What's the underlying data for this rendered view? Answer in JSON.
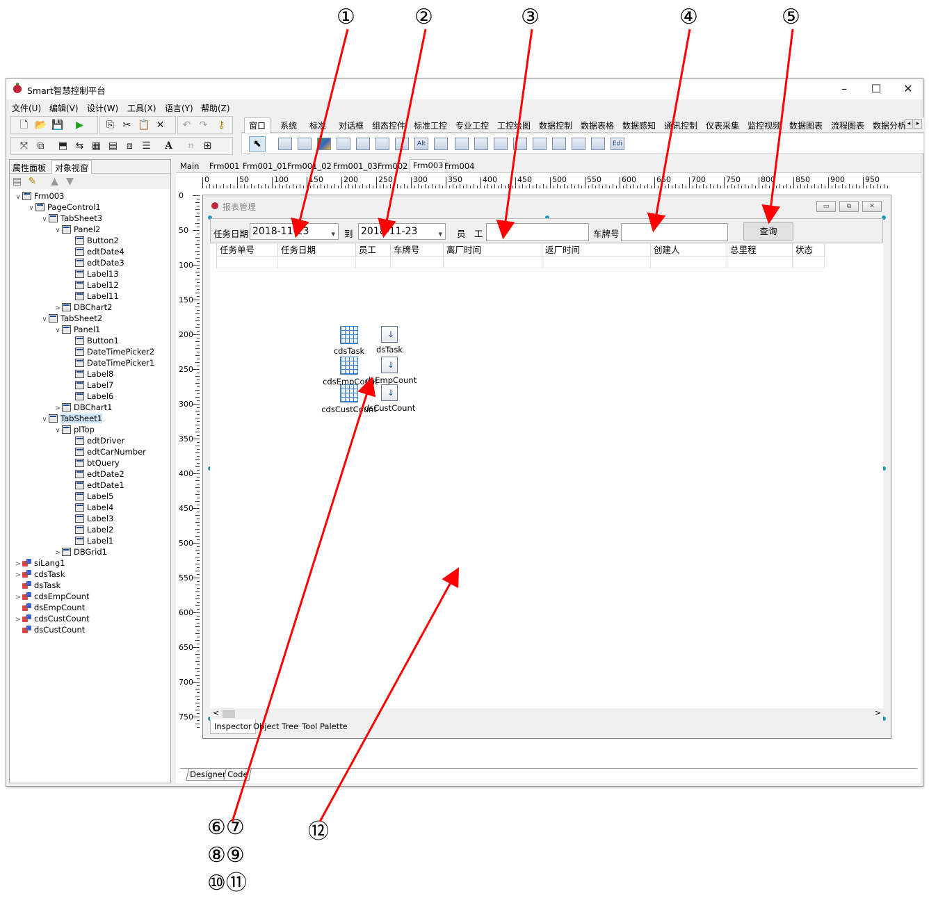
{
  "callouts": [
    "①",
    "②",
    "③",
    "④",
    "⑤",
    "⑥⑦",
    "⑧⑨",
    "⑩⑪",
    "⑫"
  ],
  "window": {
    "title": "Smart智慧控制平台",
    "controls": {
      "minimize": "–",
      "maximize": "☐",
      "close": "✕"
    },
    "menu": [
      "文件(U)",
      "编辑(V)",
      "设计(W)",
      "工具(X)",
      "语言(Y)",
      "帮助(Z)"
    ]
  },
  "palette": {
    "tabs": [
      "窗口",
      "系统",
      "标准",
      "对话框",
      "组态控件",
      "标准工控",
      "专业工控",
      "工控绘图",
      "数据控制",
      "数据表格",
      "数据感知",
      "通讯控制",
      "仪表采集",
      "监控视频",
      "数据图表",
      "流程图表",
      "数据分析"
    ],
    "active": "窗口",
    "icon_text": [
      "Alt",
      "Edi"
    ],
    "scroll": {
      "left": "◂",
      "right": "▸"
    }
  },
  "left_panel": {
    "tabs": [
      "属性面板",
      "对象视窗"
    ],
    "active": "对象视窗",
    "tree": [
      {
        "label": "Frm003",
        "level": 0,
        "exp": "∨",
        "icon": "form"
      },
      {
        "label": "PageControl1",
        "level": 1,
        "exp": "∨",
        "icon": "form"
      },
      {
        "label": "TabSheet3",
        "level": 2,
        "exp": "∨",
        "icon": "form"
      },
      {
        "label": "Panel2",
        "level": 3,
        "exp": "∨",
        "icon": "form"
      },
      {
        "label": "Button2",
        "level": 4,
        "exp": "",
        "icon": "form"
      },
      {
        "label": "edtDate4",
        "level": 4,
        "exp": "",
        "icon": "form"
      },
      {
        "label": "edtDate3",
        "level": 4,
        "exp": "",
        "icon": "form"
      },
      {
        "label": "Label13",
        "level": 4,
        "exp": "",
        "icon": "form"
      },
      {
        "label": "Label12",
        "level": 4,
        "exp": "",
        "icon": "form"
      },
      {
        "label": "Label11",
        "level": 4,
        "exp": "",
        "icon": "form"
      },
      {
        "label": "DBChart2",
        "level": 3,
        "exp": ">",
        "icon": "form"
      },
      {
        "label": "TabSheet2",
        "level": 2,
        "exp": "∨",
        "icon": "form"
      },
      {
        "label": "Panel1",
        "level": 3,
        "exp": "∨",
        "icon": "form"
      },
      {
        "label": "Button1",
        "level": 4,
        "exp": "",
        "icon": "form"
      },
      {
        "label": "DateTimePicker2",
        "level": 4,
        "exp": "",
        "icon": "form"
      },
      {
        "label": "DateTimePicker1",
        "level": 4,
        "exp": "",
        "icon": "form"
      },
      {
        "label": "Label8",
        "level": 4,
        "exp": "",
        "icon": "form"
      },
      {
        "label": "Label7",
        "level": 4,
        "exp": "",
        "icon": "form"
      },
      {
        "label": "Label6",
        "level": 4,
        "exp": "",
        "icon": "form"
      },
      {
        "label": "DBChart1",
        "level": 3,
        "exp": ">",
        "icon": "form"
      },
      {
        "label": "TabSheet1",
        "level": 2,
        "exp": "∨",
        "icon": "form",
        "selected": true
      },
      {
        "label": "plTop",
        "level": 3,
        "exp": "∨",
        "icon": "form"
      },
      {
        "label": "edtDriver",
        "level": 4,
        "exp": "",
        "icon": "form"
      },
      {
        "label": "edtCarNumber",
        "level": 4,
        "exp": "",
        "icon": "form"
      },
      {
        "label": "btQuery",
        "level": 4,
        "exp": "",
        "icon": "form"
      },
      {
        "label": "edtDate2",
        "level": 4,
        "exp": "",
        "icon": "form"
      },
      {
        "label": "edtDate1",
        "level": 4,
        "exp": "",
        "icon": "form"
      },
      {
        "label": "Label5",
        "level": 4,
        "exp": "",
        "icon": "form"
      },
      {
        "label": "Label4",
        "level": 4,
        "exp": "",
        "icon": "form"
      },
      {
        "label": "Label3",
        "level": 4,
        "exp": "",
        "icon": "form"
      },
      {
        "label": "Label2",
        "level": 4,
        "exp": "",
        "icon": "form"
      },
      {
        "label": "Label1",
        "level": 4,
        "exp": "",
        "icon": "form"
      },
      {
        "label": "DBGrid1",
        "level": 3,
        "exp": ">",
        "icon": "form"
      },
      {
        "label": "siLang1",
        "level": 0,
        "exp": ">",
        "icon": "ds"
      },
      {
        "label": "cdsTask",
        "level": 0,
        "exp": ">",
        "icon": "ds"
      },
      {
        "label": "dsTask",
        "level": 0,
        "exp": "",
        "icon": "ds"
      },
      {
        "label": "cdsEmpCount",
        "level": 0,
        "exp": ">",
        "icon": "ds"
      },
      {
        "label": "dsEmpCount",
        "level": 0,
        "exp": "",
        "icon": "ds"
      },
      {
        "label": "cdsCustCount",
        "level": 0,
        "exp": ">",
        "icon": "ds"
      },
      {
        "label": "dsCustCount",
        "level": 0,
        "exp": "",
        "icon": "ds"
      }
    ]
  },
  "doc_tabs": [
    "Main",
    "Frm001",
    "Frm001_01",
    "Frm001_02",
    "Frm001_03",
    "Frm002",
    "Frm003",
    "Frm004"
  ],
  "doc_tab_active": "Frm003",
  "ruler": {
    "h": [
      "0",
      "50",
      "100",
      "150",
      "200",
      "250",
      "300",
      "350",
      "400",
      "450",
      "500",
      "550",
      "600",
      "650",
      "700",
      "750",
      "800",
      "850",
      "900",
      "950"
    ],
    "v": [
      "0",
      "50",
      "100",
      "150",
      "200",
      "250",
      "300",
      "350",
      "400",
      "450",
      "500",
      "550",
      "600",
      "650",
      "700",
      "750"
    ]
  },
  "form": {
    "title": "报表管理",
    "query": {
      "task_date_label": "任务日期",
      "date_from": "2018-11-23",
      "to_label": "到",
      "date_to": "2018-11-23",
      "employee_label": "员　工",
      "employee_value": "",
      "plate_label": "车牌号",
      "plate_value": "",
      "query_button": "查询",
      "dropdown_glyph": "▾"
    },
    "grid_headers": [
      "任务单号",
      "任务日期",
      "员工",
      "车牌号",
      "离厂时间",
      "返厂时间",
      "创建人",
      "总里程",
      "状态"
    ],
    "components": [
      {
        "name": "cdsTask",
        "kind": "grid"
      },
      {
        "name": "dsTask",
        "kind": "ds"
      },
      {
        "name": "cdsEmpCount",
        "kind": "grid"
      },
      {
        "name": "dsEmpCount",
        "kind": "ds"
      },
      {
        "name": "cdsCustCount",
        "kind": "grid"
      },
      {
        "name": "dsCustCount",
        "kind": "ds"
      }
    ],
    "bottom_tabs": [
      "Inspector",
      "Object Tree",
      "Tool Palette"
    ],
    "bottom_tab_active": "Inspector",
    "scroll": {
      "left": "<",
      "right": ">"
    },
    "buttons": {
      "min": "▭",
      "restore": "⧉",
      "close": "✕"
    }
  },
  "designer_tabs": [
    "Designer",
    "Code"
  ]
}
